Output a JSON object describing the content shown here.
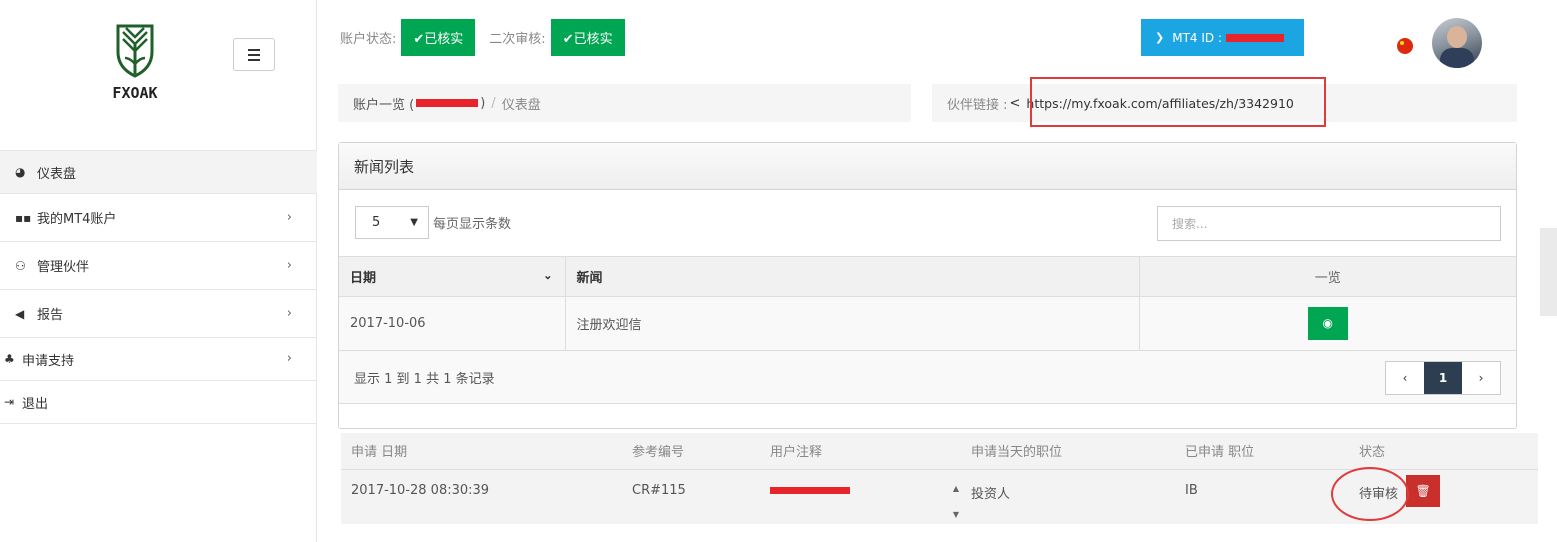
{
  "brand": {
    "name": "FXOAK"
  },
  "sidebar": {
    "items": [
      {
        "label": "仪表盘",
        "icon": "dashboard-icon"
      },
      {
        "label": "我的MT4账户",
        "icon": "grid-icon"
      },
      {
        "label": "管理伙伴",
        "icon": "sitemap-icon"
      },
      {
        "label": "报告",
        "icon": "bullhorn-icon"
      },
      {
        "label": "申请支持",
        "icon": "support-icon"
      },
      {
        "label": "退出",
        "icon": "sign-out-icon"
      }
    ]
  },
  "topbar": {
    "account_status_label": "账户状态:",
    "account_status_value": "✔已核实",
    "second_review_label": "二次审核:",
    "second_review_value": "✔已核实",
    "mt4_label": "MT4 ID :"
  },
  "breadcrumb": {
    "prefix": "账户一览 (",
    "suffix": ")",
    "current": "仪表盘"
  },
  "partner": {
    "label": "伙伴链接 :",
    "url": "https://my.fxoak.com/affiliates/zh/3342910"
  },
  "news": {
    "title": "新闻列表",
    "per_page_value": "5",
    "per_page_label": "每页显示条数",
    "search_placeholder": "搜索...",
    "columns": {
      "date": "日期",
      "news": "新闻",
      "view": "一览"
    },
    "rows": [
      {
        "date": "2017-10-06",
        "news": "注册欢迎信"
      }
    ],
    "footer": "显示 1 到 1 共 1 条记录",
    "pager": {
      "prev": "‹",
      "current": "1",
      "next": "›"
    }
  },
  "support": {
    "columns": {
      "date": "申请 日期",
      "ref": "参考编号",
      "note": "用户注释",
      "position_at_request": "申请当天的职位",
      "requested_position": "已申请 职位",
      "status": "状态"
    },
    "rows": [
      {
        "date": "2017-10-28 08:30:39",
        "ref": "CR#115",
        "position_at_request": "投资人",
        "requested_position": "IB",
        "status": "待审核"
      }
    ]
  },
  "colors": {
    "success": "#00a651",
    "info": "#1ba6e3",
    "danger": "#c9302c",
    "highlight": "#e03a3a"
  }
}
